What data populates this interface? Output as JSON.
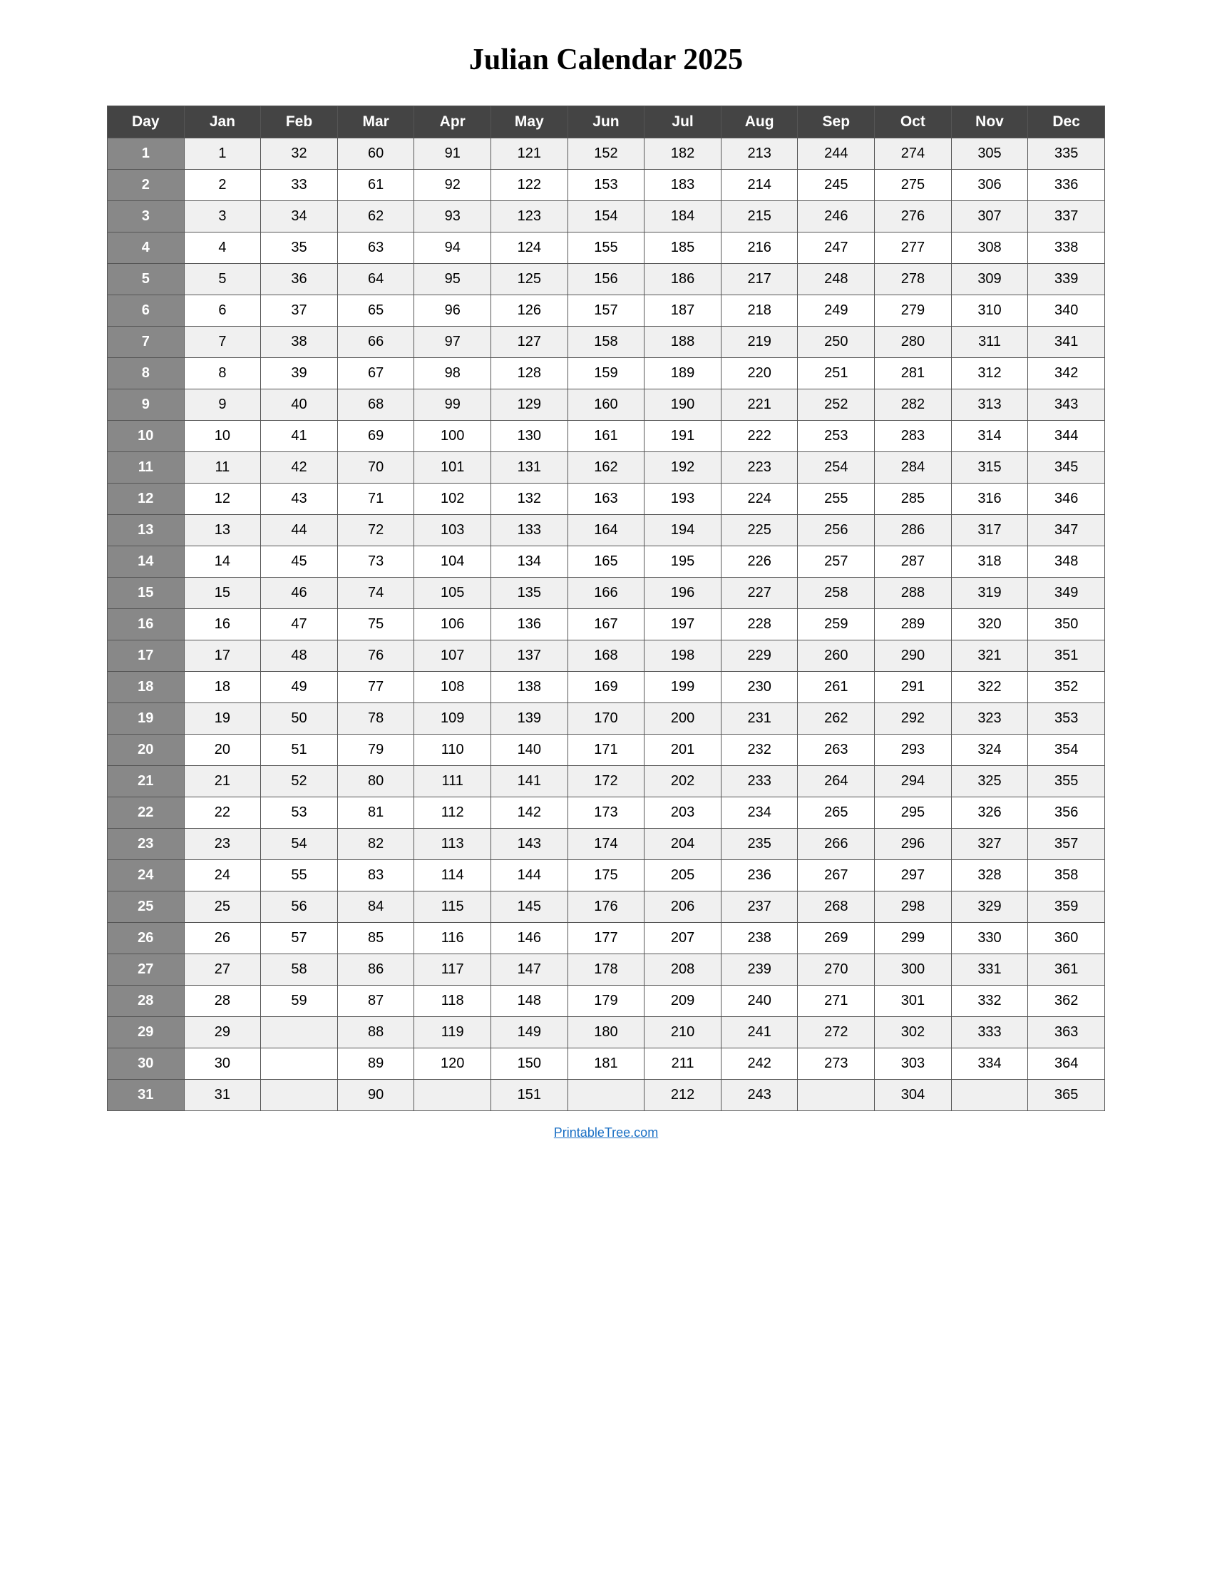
{
  "title": "Julian Calendar 2025",
  "footer_link": "PrintableTree.com",
  "columns": [
    "Day",
    "Jan",
    "Feb",
    "Mar",
    "Apr",
    "May",
    "Jun",
    "Jul",
    "Aug",
    "Sep",
    "Oct",
    "Nov",
    "Dec"
  ],
  "rows": [
    {
      "day": 1,
      "Jan": 1,
      "Feb": 32,
      "Mar": 60,
      "Apr": 91,
      "May": 121,
      "Jun": 152,
      "Jul": 182,
      "Aug": 213,
      "Sep": 244,
      "Oct": 274,
      "Nov": 305,
      "Dec": 335
    },
    {
      "day": 2,
      "Jan": 2,
      "Feb": 33,
      "Mar": 61,
      "Apr": 92,
      "May": 122,
      "Jun": 153,
      "Jul": 183,
      "Aug": 214,
      "Sep": 245,
      "Oct": 275,
      "Nov": 306,
      "Dec": 336
    },
    {
      "day": 3,
      "Jan": 3,
      "Feb": 34,
      "Mar": 62,
      "Apr": 93,
      "May": 123,
      "Jun": 154,
      "Jul": 184,
      "Aug": 215,
      "Sep": 246,
      "Oct": 276,
      "Nov": 307,
      "Dec": 337
    },
    {
      "day": 4,
      "Jan": 4,
      "Feb": 35,
      "Mar": 63,
      "Apr": 94,
      "May": 124,
      "Jun": 155,
      "Jul": 185,
      "Aug": 216,
      "Sep": 247,
      "Oct": 277,
      "Nov": 308,
      "Dec": 338
    },
    {
      "day": 5,
      "Jan": 5,
      "Feb": 36,
      "Mar": 64,
      "Apr": 95,
      "May": 125,
      "Jun": 156,
      "Jul": 186,
      "Aug": 217,
      "Sep": 248,
      "Oct": 278,
      "Nov": 309,
      "Dec": 339
    },
    {
      "day": 6,
      "Jan": 6,
      "Feb": 37,
      "Mar": 65,
      "Apr": 96,
      "May": 126,
      "Jun": 157,
      "Jul": 187,
      "Aug": 218,
      "Sep": 249,
      "Oct": 279,
      "Nov": 310,
      "Dec": 340
    },
    {
      "day": 7,
      "Jan": 7,
      "Feb": 38,
      "Mar": 66,
      "Apr": 97,
      "May": 127,
      "Jun": 158,
      "Jul": 188,
      "Aug": 219,
      "Sep": 250,
      "Oct": 280,
      "Nov": 311,
      "Dec": 341
    },
    {
      "day": 8,
      "Jan": 8,
      "Feb": 39,
      "Mar": 67,
      "Apr": 98,
      "May": 128,
      "Jun": 159,
      "Jul": 189,
      "Aug": 220,
      "Sep": 251,
      "Oct": 281,
      "Nov": 312,
      "Dec": 342
    },
    {
      "day": 9,
      "Jan": 9,
      "Feb": 40,
      "Mar": 68,
      "Apr": 99,
      "May": 129,
      "Jun": 160,
      "Jul": 190,
      "Aug": 221,
      "Sep": 252,
      "Oct": 282,
      "Nov": 313,
      "Dec": 343
    },
    {
      "day": 10,
      "Jan": 10,
      "Feb": 41,
      "Mar": 69,
      "Apr": 100,
      "May": 130,
      "Jun": 161,
      "Jul": 191,
      "Aug": 222,
      "Sep": 253,
      "Oct": 283,
      "Nov": 314,
      "Dec": 344
    },
    {
      "day": 11,
      "Jan": 11,
      "Feb": 42,
      "Mar": 70,
      "Apr": 101,
      "May": 131,
      "Jun": 162,
      "Jul": 192,
      "Aug": 223,
      "Sep": 254,
      "Oct": 284,
      "Nov": 315,
      "Dec": 345
    },
    {
      "day": 12,
      "Jan": 12,
      "Feb": 43,
      "Mar": 71,
      "Apr": 102,
      "May": 132,
      "Jun": 163,
      "Jul": 193,
      "Aug": 224,
      "Sep": 255,
      "Oct": 285,
      "Nov": 316,
      "Dec": 346
    },
    {
      "day": 13,
      "Jan": 13,
      "Feb": 44,
      "Mar": 72,
      "Apr": 103,
      "May": 133,
      "Jun": 164,
      "Jul": 194,
      "Aug": 225,
      "Sep": 256,
      "Oct": 286,
      "Nov": 317,
      "Dec": 347
    },
    {
      "day": 14,
      "Jan": 14,
      "Feb": 45,
      "Mar": 73,
      "Apr": 104,
      "May": 134,
      "Jun": 165,
      "Jul": 195,
      "Aug": 226,
      "Sep": 257,
      "Oct": 287,
      "Nov": 318,
      "Dec": 348
    },
    {
      "day": 15,
      "Jan": 15,
      "Feb": 46,
      "Mar": 74,
      "Apr": 105,
      "May": 135,
      "Jun": 166,
      "Jul": 196,
      "Aug": 227,
      "Sep": 258,
      "Oct": 288,
      "Nov": 319,
      "Dec": 349
    },
    {
      "day": 16,
      "Jan": 16,
      "Feb": 47,
      "Mar": 75,
      "Apr": 106,
      "May": 136,
      "Jun": 167,
      "Jul": 197,
      "Aug": 228,
      "Sep": 259,
      "Oct": 289,
      "Nov": 320,
      "Dec": 350
    },
    {
      "day": 17,
      "Jan": 17,
      "Feb": 48,
      "Mar": 76,
      "Apr": 107,
      "May": 137,
      "Jun": 168,
      "Jul": 198,
      "Aug": 229,
      "Sep": 260,
      "Oct": 290,
      "Nov": 321,
      "Dec": 351
    },
    {
      "day": 18,
      "Jan": 18,
      "Feb": 49,
      "Mar": 77,
      "Apr": 108,
      "May": 138,
      "Jun": 169,
      "Jul": 199,
      "Aug": 230,
      "Sep": 261,
      "Oct": 291,
      "Nov": 322,
      "Dec": 352
    },
    {
      "day": 19,
      "Jan": 19,
      "Feb": 50,
      "Mar": 78,
      "Apr": 109,
      "May": 139,
      "Jun": 170,
      "Jul": 200,
      "Aug": 231,
      "Sep": 262,
      "Oct": 292,
      "Nov": 323,
      "Dec": 353
    },
    {
      "day": 20,
      "Jan": 20,
      "Feb": 51,
      "Mar": 79,
      "Apr": 110,
      "May": 140,
      "Jun": 171,
      "Jul": 201,
      "Aug": 232,
      "Sep": 263,
      "Oct": 293,
      "Nov": 324,
      "Dec": 354
    },
    {
      "day": 21,
      "Jan": 21,
      "Feb": 52,
      "Mar": 80,
      "Apr": 111,
      "May": 141,
      "Jun": 172,
      "Jul": 202,
      "Aug": 233,
      "Sep": 264,
      "Oct": 294,
      "Nov": 325,
      "Dec": 355
    },
    {
      "day": 22,
      "Jan": 22,
      "Feb": 53,
      "Mar": 81,
      "Apr": 112,
      "May": 142,
      "Jun": 173,
      "Jul": 203,
      "Aug": 234,
      "Sep": 265,
      "Oct": 295,
      "Nov": 326,
      "Dec": 356
    },
    {
      "day": 23,
      "Jan": 23,
      "Feb": 54,
      "Mar": 82,
      "Apr": 113,
      "May": 143,
      "Jun": 174,
      "Jul": 204,
      "Aug": 235,
      "Sep": 266,
      "Oct": 296,
      "Nov": 327,
      "Dec": 357
    },
    {
      "day": 24,
      "Jan": 24,
      "Feb": 55,
      "Mar": 83,
      "Apr": 114,
      "May": 144,
      "Jun": 175,
      "Jul": 205,
      "Aug": 236,
      "Sep": 267,
      "Oct": 297,
      "Nov": 328,
      "Dec": 358
    },
    {
      "day": 25,
      "Jan": 25,
      "Feb": 56,
      "Mar": 84,
      "Apr": 115,
      "May": 145,
      "Jun": 176,
      "Jul": 206,
      "Aug": 237,
      "Sep": 268,
      "Oct": 298,
      "Nov": 329,
      "Dec": 359
    },
    {
      "day": 26,
      "Jan": 26,
      "Feb": 57,
      "Mar": 85,
      "Apr": 116,
      "May": 146,
      "Jun": 177,
      "Jul": 207,
      "Aug": 238,
      "Sep": 269,
      "Oct": 299,
      "Nov": 330,
      "Dec": 360
    },
    {
      "day": 27,
      "Jan": 27,
      "Feb": 58,
      "Mar": 86,
      "Apr": 117,
      "May": 147,
      "Jun": 178,
      "Jul": 208,
      "Aug": 239,
      "Sep": 270,
      "Oct": 300,
      "Nov": 331,
      "Dec": 361
    },
    {
      "day": 28,
      "Jan": 28,
      "Feb": 59,
      "Mar": 87,
      "Apr": 118,
      "May": 148,
      "Jun": 179,
      "Jul": 209,
      "Aug": 240,
      "Sep": 271,
      "Oct": 301,
      "Nov": 332,
      "Dec": 362
    },
    {
      "day": 29,
      "Jan": 29,
      "Feb": "",
      "Mar": 88,
      "Apr": 119,
      "May": 149,
      "Jun": 180,
      "Jul": 210,
      "Aug": 241,
      "Sep": 272,
      "Oct": 302,
      "Nov": 333,
      "Dec": 363
    },
    {
      "day": 30,
      "Jan": 30,
      "Feb": "",
      "Mar": 89,
      "Apr": 120,
      "May": 150,
      "Jun": 181,
      "Jul": 211,
      "Aug": 242,
      "Sep": 273,
      "Oct": 303,
      "Nov": 334,
      "Dec": 364
    },
    {
      "day": 31,
      "Jan": 31,
      "Feb": "",
      "Mar": 90,
      "Apr": "",
      "May": 151,
      "Jun": "",
      "Jul": 212,
      "Aug": 243,
      "Sep": "",
      "Oct": 304,
      "Nov": "",
      "Dec": 365
    }
  ]
}
